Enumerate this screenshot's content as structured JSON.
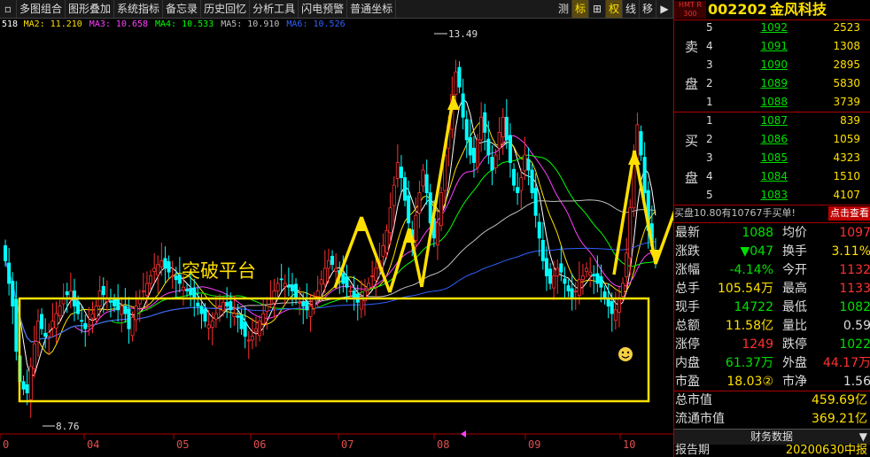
{
  "toolbar": {
    "items": [
      "多图组合",
      "图形叠加",
      "系统指标",
      "备忘录",
      "历史回忆",
      "分析工具",
      "闪电预警",
      "普通坐标"
    ],
    "right_items": [
      "测",
      "标",
      "⊞",
      "权",
      "线",
      "移"
    ]
  },
  "ma_legend": [
    {
      "label": "518",
      "color": "#ffffff"
    },
    {
      "label": "MA2: 11.210",
      "color": "#ffe000"
    },
    {
      "label": "MA3: 10.658",
      "color": "#ff40ff"
    },
    {
      "label": "MA4: 10.533",
      "color": "#00ff00"
    },
    {
      "label": "MA5: 10.910",
      "color": "#c0c0c0"
    },
    {
      "label": "MA6: 10.526",
      "color": "#3060ff"
    }
  ],
  "chart_data": {
    "type": "candlestick",
    "months": [
      "0",
      "04",
      "05",
      "06",
      "07",
      "08",
      "09",
      "10"
    ],
    "high_label": "13.49",
    "low_label": "8.76",
    "annotation": "突破平台",
    "closes": [
      10.6,
      10.3,
      10.0,
      9.4,
      9.0,
      8.9,
      8.85,
      9.2,
      9.5,
      9.8,
      9.7,
      9.6,
      9.65,
      9.8,
      9.9,
      10.0,
      10.1,
      10.15,
      10.2,
      10.0,
      9.9,
      9.8,
      9.7,
      9.75,
      9.9,
      10.0,
      10.2,
      10.15,
      10.1,
      10.05,
      10.0,
      9.95,
      10.0,
      9.9,
      9.7,
      9.85,
      10.0,
      10.1,
      10.2,
      10.3,
      10.4,
      10.5,
      10.55,
      10.6,
      10.5,
      10.45,
      10.4,
      10.35,
      10.3,
      10.25,
      10.2,
      10.15,
      10.1,
      10.0,
      9.9,
      9.8,
      9.75,
      9.8,
      9.9,
      10.0,
      10.05,
      10.0,
      9.95,
      9.9,
      9.85,
      9.7,
      9.6,
      9.55,
      9.6,
      9.7,
      9.8,
      9.9,
      10.0,
      10.1,
      10.2,
      10.3,
      10.35,
      10.3,
      10.25,
      10.2,
      10.1,
      10.05,
      10.0,
      9.95,
      10.0,
      10.1,
      10.2,
      10.35,
      10.5,
      10.6,
      10.55,
      10.5,
      10.4,
      10.3,
      10.25,
      10.2,
      10.1,
      10.05,
      10.1,
      10.2,
      10.3,
      10.4,
      10.5,
      10.6,
      10.8,
      11.0,
      11.3,
      11.6,
      11.9,
      11.7,
      11.4,
      11.1,
      10.9,
      11.2,
      11.5,
      11.8,
      11.5,
      11.1,
      10.9,
      11.1,
      11.5,
      12.0,
      12.4,
      12.8,
      13.1,
      12.9,
      12.5,
      12.2,
      12.0,
      11.9,
      12.2,
      12.5,
      12.3,
      12.0,
      11.8,
      12.0,
      12.3,
      12.5,
      12.2,
      11.9,
      11.6,
      11.5,
      11.7,
      12.0,
      11.8,
      11.5,
      11.2,
      10.9,
      10.6,
      10.4,
      10.3,
      10.4,
      10.5,
      10.45,
      10.3,
      10.2,
      10.1,
      10.2,
      10.35,
      10.4,
      10.5,
      10.45,
      10.4,
      10.3,
      10.25,
      10.1,
      10.0,
      9.9,
      9.95,
      10.1,
      10.3,
      10.7,
      11.3,
      11.9,
      12.4,
      12.0,
      11.5,
      11.0,
      10.8,
      10.7
    ]
  },
  "orderbook": {
    "sell_label": [
      "卖",
      "盘"
    ],
    "buy_label": [
      "买",
      "盘"
    ],
    "sell": [
      {
        "lv": "5",
        "price": "1092",
        "vol": "2523"
      },
      {
        "lv": "4",
        "price": "1091",
        "vol": "1308"
      },
      {
        "lv": "3",
        "price": "1090",
        "vol": "2895"
      },
      {
        "lv": "2",
        "price": "1089",
        "vol": "5830"
      },
      {
        "lv": "1",
        "price": "1088",
        "vol": "3739"
      }
    ],
    "buy": [
      {
        "lv": "1",
        "price": "1087",
        "vol": "839"
      },
      {
        "lv": "2",
        "price": "1086",
        "vol": "1059"
      },
      {
        "lv": "3",
        "price": "1085",
        "vol": "4323"
      },
      {
        "lv": "4",
        "price": "1084",
        "vol": "1510"
      },
      {
        "lv": "5",
        "price": "1083",
        "vol": "4107"
      }
    ]
  },
  "stock": {
    "tag": "HMT R 300",
    "code": "002202",
    "name": "金风科技"
  },
  "note": {
    "text": "买盘10.80有10767手买单!",
    "button": "点击查看"
  },
  "quote": [
    {
      "k": "最新",
      "v": "1088",
      "vc": "green",
      "k2": "均价",
      "v2": "1097",
      "vc2": "red"
    },
    {
      "k": "涨跌",
      "v": "▼047",
      "vc": "green",
      "k2": "换手",
      "v2": "3.11%",
      "vc2": "yellow"
    },
    {
      "k": "涨幅",
      "v": "-4.14%",
      "vc": "green",
      "k2": "今开",
      "v2": "1132",
      "vc2": "red"
    },
    {
      "k": "总手",
      "v": "105.54万",
      "vc": "yellow",
      "k2": "最高",
      "v2": "1133",
      "vc2": "red"
    },
    {
      "k": "现手",
      "v": "14722",
      "vc": "green",
      "k2": "最低",
      "v2": "1082",
      "vc2": "green"
    },
    {
      "k": "总额",
      "v": "11.58亿",
      "vc": "yellow",
      "k2": "量比",
      "v2": "0.59",
      "vc2": "white"
    },
    {
      "k": "涨停",
      "v": "1249",
      "vc": "red",
      "k2": "跌停",
      "v2": "1022",
      "vc2": "green"
    },
    {
      "k": "内盘",
      "v": "61.37万",
      "vc": "green",
      "k2": "外盘",
      "v2": "44.17万",
      "vc2": "red"
    },
    {
      "k": "市盈",
      "v": "18.03②",
      "vc": "yellow",
      "k2": "市净",
      "v2": "1.56",
      "vc2": "white"
    }
  ],
  "cap": [
    {
      "k": "总市值",
      "v": "459.69亿"
    },
    {
      "k": "流通市值",
      "v": "369.21亿"
    }
  ],
  "fin": {
    "title": "财务数据",
    "dd": "▼"
  },
  "last": {
    "k": "报告期",
    "v": "20200630中报"
  }
}
